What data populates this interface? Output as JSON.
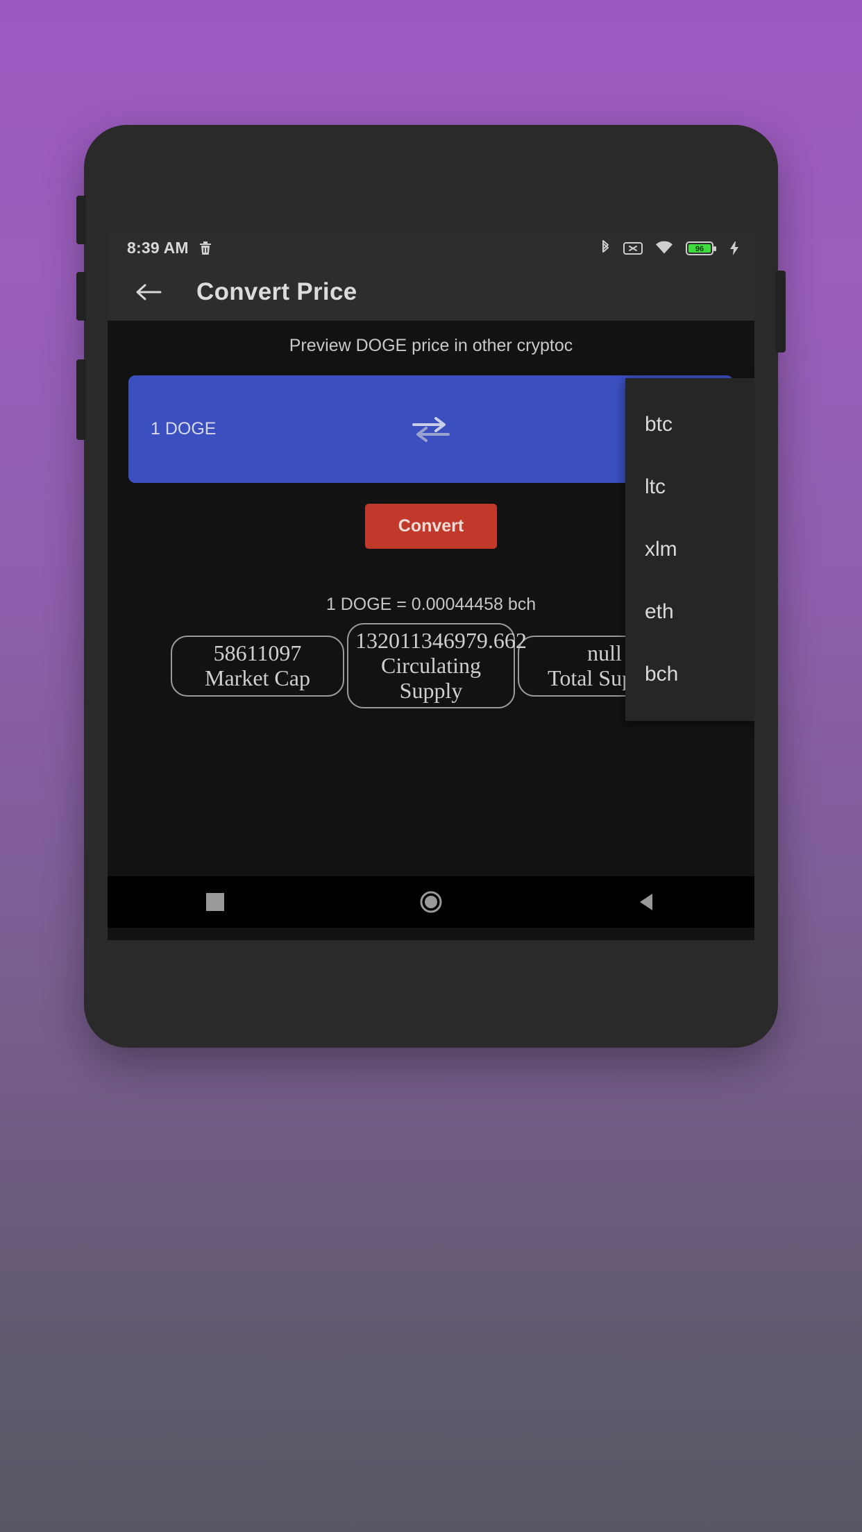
{
  "status_bar": {
    "time": "8:39 AM",
    "icons": [
      "trash-icon",
      "bluetooth-icon",
      "sim-missing-icon",
      "wifi-icon",
      "battery-icon",
      "charging-bolt-icon"
    ],
    "battery_level": "96"
  },
  "app_bar": {
    "back_icon": "arrow-left-icon",
    "title": "Convert Price"
  },
  "content": {
    "subtitle": "Preview DOGE price in other cryptoc",
    "amount_label": "1 DOGE",
    "swap_icon": "swap-horizontal-icon",
    "convert_label": "Convert",
    "result": "1 DOGE = 0.00044458 bch"
  },
  "stats": [
    {
      "value": "58611097",
      "label": "Market Cap"
    },
    {
      "value": "132011346979.662",
      "label": "Circulating Supply"
    },
    {
      "value": "null",
      "label": "Total Supply"
    }
  ],
  "dropdown": {
    "items": [
      {
        "label": "btc"
      },
      {
        "label": "ltc"
      },
      {
        "label": "xlm"
      },
      {
        "label": "eth"
      },
      {
        "label": "bch"
      }
    ]
  },
  "nav_bar": {
    "recents": "square-icon",
    "home": "circle-icon",
    "back": "triangle-back-icon"
  },
  "colors": {
    "background_top": "#9b59c0",
    "background_bottom": "#575763",
    "card_blue": "#3b4fbf",
    "button_red": "#c0392b",
    "battery_green": "#3ddb3d",
    "screen_dark": "#121212",
    "bar_dark": "#2d2d2d"
  }
}
